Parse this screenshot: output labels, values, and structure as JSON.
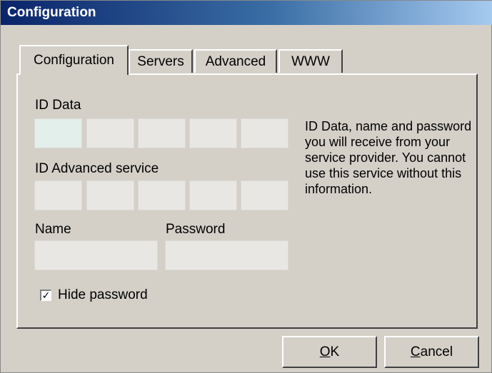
{
  "window": {
    "title": "Configuration"
  },
  "tabs": [
    {
      "label": "Configuration",
      "active": true
    },
    {
      "label": "Servers",
      "active": false
    },
    {
      "label": "Advanced",
      "active": false
    },
    {
      "label": "WWW",
      "active": false
    }
  ],
  "form": {
    "id_data_label": "ID Data",
    "id_data_values": [
      "",
      "",
      "",
      "",
      ""
    ],
    "id_advanced_label": "ID Advanced service",
    "id_advanced_values": [
      "",
      "",
      "",
      "",
      ""
    ],
    "name_label": "Name",
    "name_value": "",
    "password_label": "Password",
    "password_value": "",
    "hide_password_label": "Hide password",
    "hide_password_checked": true
  },
  "info_text": "ID Data, name and password you will receive from your service provider. You cannot use this service without this information.",
  "buttons": {
    "ok_mnemonic": "O",
    "ok_rest": "K",
    "cancel_mnemonic": "C",
    "cancel_rest": "ancel"
  },
  "colors": {
    "title_start": "#0a246a",
    "title_end": "#a6caf0",
    "dialog_bg": "#d4d0c8",
    "field_bg": "#e9e7e4",
    "focused_field_bg": "#e3efea"
  }
}
